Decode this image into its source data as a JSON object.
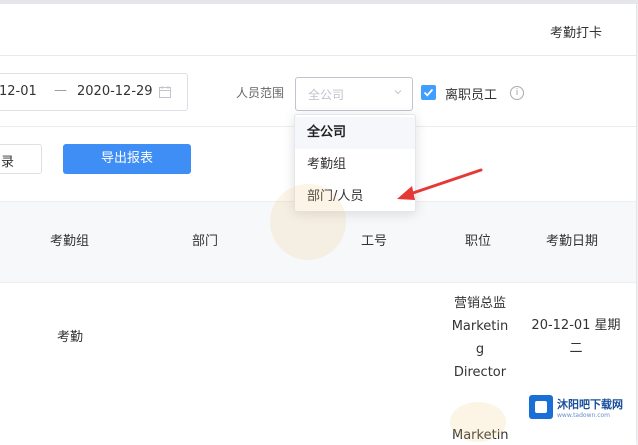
{
  "header": {
    "attendance_punch_link": "考勤打卡"
  },
  "filters": {
    "date_start": "12-01",
    "date_separator": "—",
    "date_end": "2020-12-29",
    "scope_label": "人员范围",
    "scope_placeholder": "全公司",
    "include_resigned_checked": true,
    "include_resigned_label": "离职员工",
    "info_symbol": "i"
  },
  "actions": {
    "partial_button_label": "录",
    "export_button_label": "导出报表"
  },
  "dropdown": {
    "options": [
      {
        "label": "全公司",
        "highlighted": true
      },
      {
        "label": "考勤组",
        "highlighted": false
      },
      {
        "label": "部门/人员",
        "highlighted": false
      }
    ]
  },
  "table": {
    "columns": [
      "考勤组",
      "部门",
      "工号",
      "职位",
      "考勤日期"
    ],
    "row": {
      "attendance_group": "考勤",
      "position_lines": [
        "营销总监",
        "Marketin",
        "g",
        "Director"
      ],
      "date_lines": [
        "20-12-01 星期",
        "二"
      ],
      "next_row_partial": "Marketin"
    }
  },
  "watermark": {
    "logo_text": "沐阳吧下载网",
    "logo_subtext": "www.tadown.com"
  },
  "colors": {
    "primary": "#3f8ef5",
    "checkbox": "#409eff",
    "arrow": "#e53935"
  }
}
